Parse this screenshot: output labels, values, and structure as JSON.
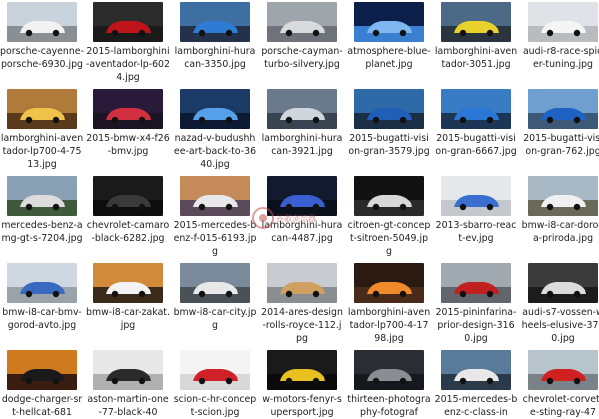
{
  "files": [
    {
      "name": "porsche-cayenne-porsche-6930.jpg",
      "sky": "#c9d3dc",
      "ground": "#8a8f94",
      "car": "#f2f2f2"
    },
    {
      "name": "2015-lamborghini-aventador-lp-6024.jpg",
      "sky": "#2b2b2b",
      "ground": "#1a1a1a",
      "car": "#c0141b"
    },
    {
      "name": "lamborghini-huracan-3350.jpg",
      "sky": "#3e6fa3",
      "ground": "#23324a",
      "car": "#2f7bd3"
    },
    {
      "name": "porsche-cayman-turbo-silvery.jpg",
      "sky": "#9ea5ab",
      "ground": "#6d7378",
      "car": "#d9dadc"
    },
    {
      "name": "atmosphere-blue-planet.jpg",
      "sky": "#0b1f4a",
      "ground": "#3a7fd0",
      "car": "#7fb7f0"
    },
    {
      "name": "lamborghini-aventador-3051.jpg",
      "sky": "#4c6a86",
      "ground": "#2b3540",
      "car": "#e8d12a"
    },
    {
      "name": "audi-r8-race-spider-tuning.jpg",
      "sky": "#dfe3e7",
      "ground": "#b9bcbf",
      "car": "#f5f5f5"
    },
    {
      "name": "lamborghini-aventador-lp700-4-7513.jpg",
      "sky": "#b07a3a",
      "ground": "#5a3a1a",
      "car": "#f0c24a"
    },
    {
      "name": "2015-bmw-x4-f26-bmv.jpg",
      "sky": "#2a1a3a",
      "ground": "#1c1424",
      "car": "#d03040"
    },
    {
      "name": "nazad-v-budushhee-art-back-to-3640.jpg",
      "sky": "#1b3a66",
      "ground": "#0c1a33",
      "car": "#55a0e8"
    },
    {
      "name": "lamborghini-huracan-3921.jpg",
      "sky": "#6a7a8c",
      "ground": "#3a4350",
      "car": "#cfd6de"
    },
    {
      "name": "2015-bugatti-vision-gran-3579.jpg",
      "sky": "#2f6aa8",
      "ground": "#1a2e45",
      "car": "#1f5fb8"
    },
    {
      "name": "2015-bugatti-vision-gran-6667.jpg",
      "sky": "#3a7cc4",
      "ground": "#1c3656",
      "car": "#2a78d6"
    },
    {
      "name": "2015-bugatti-vision-gran-762.jpg",
      "sky": "#6e9fcf",
      "ground": "#3c5a78",
      "car": "#1e63c4"
    },
    {
      "name": "mercedes-benz-amg-gt-s-7204.jpg",
      "sky": "#8aa1b5",
      "ground": "#3f5a3a",
      "car": "#dcdcdc"
    },
    {
      "name": "chevrolet-camaro-black-6282.jpg",
      "sky": "#1a1a1a",
      "ground": "#0d0d0d",
      "car": "#3a3a3a"
    },
    {
      "name": "2015-mercedes-benz-f-015-6193.jpg",
      "sky": "#c48a5a",
      "ground": "#5a4a5a",
      "car": "#e8e8ec"
    },
    {
      "name": "lamborghini-huracan-4487.jpg",
      "sky": "#111a2e",
      "ground": "#0a0f1c",
      "car": "#3a5fd0"
    },
    {
      "name": "citroen-gt-concept-sitroen-5049.jpg",
      "sky": "#121212",
      "ground": "#2a2a2a",
      "car": "#d8d8d8"
    },
    {
      "name": "2013-sbarro-react-ev.jpg",
      "sky": "#e6e9ec",
      "ground": "#c4c8cc",
      "car": "#3a6fd0"
    },
    {
      "name": "bmw-i8-car-doroga-priroda.jpg",
      "sky": "#a8b8c4",
      "ground": "#6a6a5a",
      "car": "#f0f0f0"
    },
    {
      "name": "bmw-i8-car-bmv-gorod-avto.jpg",
      "sky": "#cfd8e0",
      "ground": "#9aa2aa",
      "car": "#3a6ac0"
    },
    {
      "name": "bmw-i8-car-zakat.jpg",
      "sky": "#d08a3a",
      "ground": "#3a2a1a",
      "car": "#f2f2f2"
    },
    {
      "name": "bmw-i8-car-city.jpg",
      "sky": "#7a8a9a",
      "ground": "#4a5258",
      "car": "#e8e8e8"
    },
    {
      "name": "2014-ares-design-rolls-royce-112.jpg",
      "sky": "#c8ccd0",
      "ground": "#8a8e92",
      "car": "#d0a060"
    },
    {
      "name": "lamborghini-aventador-lp700-4-1798.jpg",
      "sky": "#2a1a12",
      "ground": "#4a2a18",
      "car": "#f08a2a"
    },
    {
      "name": "2015-pininfarina-prior-design-3160.jpg",
      "sky": "#a0a8b0",
      "ground": "#60666c",
      "car": "#c02020"
    },
    {
      "name": "audi-s7-vossen-wheels-elusive-3770.jpg",
      "sky": "#3a3a3a",
      "ground": "#1c1c1c",
      "car": "#dcdcdc"
    },
    {
      "name": "dodge-charger-srt-hellcat-681",
      "sky": "#d07a20",
      "ground": "#3a1c10",
      "car": "#1a1a1a"
    },
    {
      "name": "aston-martin-one-77-black-40",
      "sky": "#e8e8e8",
      "ground": "#b0b0b0",
      "car": "#2a2a2a"
    },
    {
      "name": "scion-c-hr-concept-scion.jpg",
      "sky": "#f4f4f4",
      "ground": "#d8d8d8",
      "car": "#d02028"
    },
    {
      "name": "w-motors-fenyr-supersport.jpg",
      "sky": "#1a1a1a",
      "ground": "#0a0a0a",
      "car": "#e8c020"
    },
    {
      "name": "thirteen-photography-fotograf",
      "sky": "#2a2e34",
      "ground": "#15181c",
      "car": "#8a8e92"
    },
    {
      "name": "2015-mercedes-benz-c-class-in",
      "sky": "#5a7a9a",
      "ground": "#2a3a4a",
      "car": "#e8e8e8"
    },
    {
      "name": "chevrolet-corvette-sting-ray-47",
      "sky": "#b8c4cc",
      "ground": "#7a8288",
      "car": "#d02020"
    }
  ],
  "watermark": {
    "text": "谷歌浏览器"
  }
}
